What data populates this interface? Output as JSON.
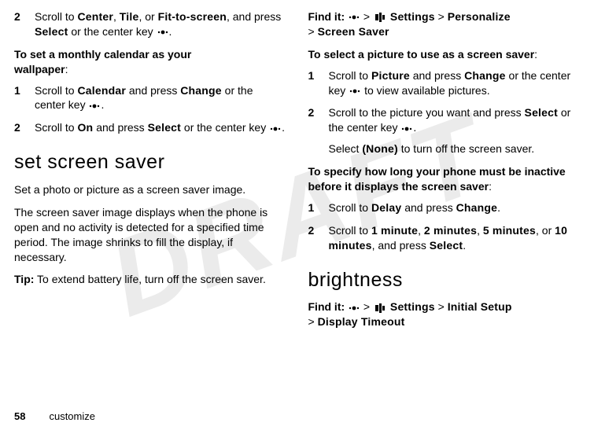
{
  "watermark": "DRAFT",
  "left": {
    "step2": {
      "num": "2",
      "t1": "Scroll to ",
      "center": "Center",
      "comma1": ", ",
      "tile": "Tile",
      "t2": ", or ",
      "fit": "Fit-to-screen",
      "t3": ", and press ",
      "select": "Select",
      "t4": " or the center key ",
      "period": "."
    },
    "lead1a": "To set a monthly calendar as your",
    "lead1b": "wallpaper",
    "lead1c": ":",
    "s1": {
      "num": "1",
      "t1": "Scroll to ",
      "calendar": "Calendar",
      "t2": " and press ",
      "change": "Change",
      "t3": " or the center key ",
      "period": "."
    },
    "s2": {
      "num": "2",
      "t1": "Scroll to ",
      "on": "On",
      "t2": " and press ",
      "select": "Select",
      "t3": " or the center key ",
      "period": "."
    },
    "heading": "set screen saver",
    "p1": "Set a photo or picture as a screen saver image.",
    "p2": "The screen saver image displays when the phone is open and no activity is detected for a specified time period. The image shrinks to fill the display, if necessary.",
    "tip_label": "Tip:",
    "tip_text": " To extend battery life, turn off the screen saver."
  },
  "right": {
    "find_label": "Find it:",
    "gt": " > ",
    "settings": "Settings",
    "personalize": "Personalize",
    "screensaver": "Screen Saver",
    "lead2": "To select a picture to use as a screen saver",
    "lead2c": ":",
    "r1": {
      "num": "1",
      "t1": "Scroll to ",
      "picture": "Picture",
      "t2": " and press ",
      "change": "Change",
      "t3": " or the center key ",
      "t4": " to view available pictures."
    },
    "r2": {
      "num": "2",
      "t1": "Scroll to the picture you want and press ",
      "select": "Select",
      "t2": " or the center key ",
      "period": "."
    },
    "r3a": "Select ",
    "none": "(None)",
    "r3b": " to turn off the screen saver.",
    "lead3a": "To specify how long your phone must be inactive before it displays the screen saver",
    "lead3c": ":",
    "d1": {
      "num": "1",
      "t1": "Scroll to ",
      "delay": "Delay",
      "t2": " and press ",
      "change": "Change",
      "period": "."
    },
    "d2": {
      "num": "2",
      "t1": "Scroll to ",
      "o1": "1 minute",
      "c1": ", ",
      "o2": "2 minutes",
      "c2": ", ",
      "o3": "5 minutes",
      "c3": ", or ",
      "o4": "10 minutes",
      "t2": ", and press ",
      "select": "Select",
      "period": "."
    },
    "heading2": "brightness",
    "find2_label": "Find it:",
    "settings2": "Settings",
    "initial": "Initial Setup",
    "display_timeout": "Display Timeout"
  },
  "footer": {
    "page": "58",
    "section": "customize"
  }
}
